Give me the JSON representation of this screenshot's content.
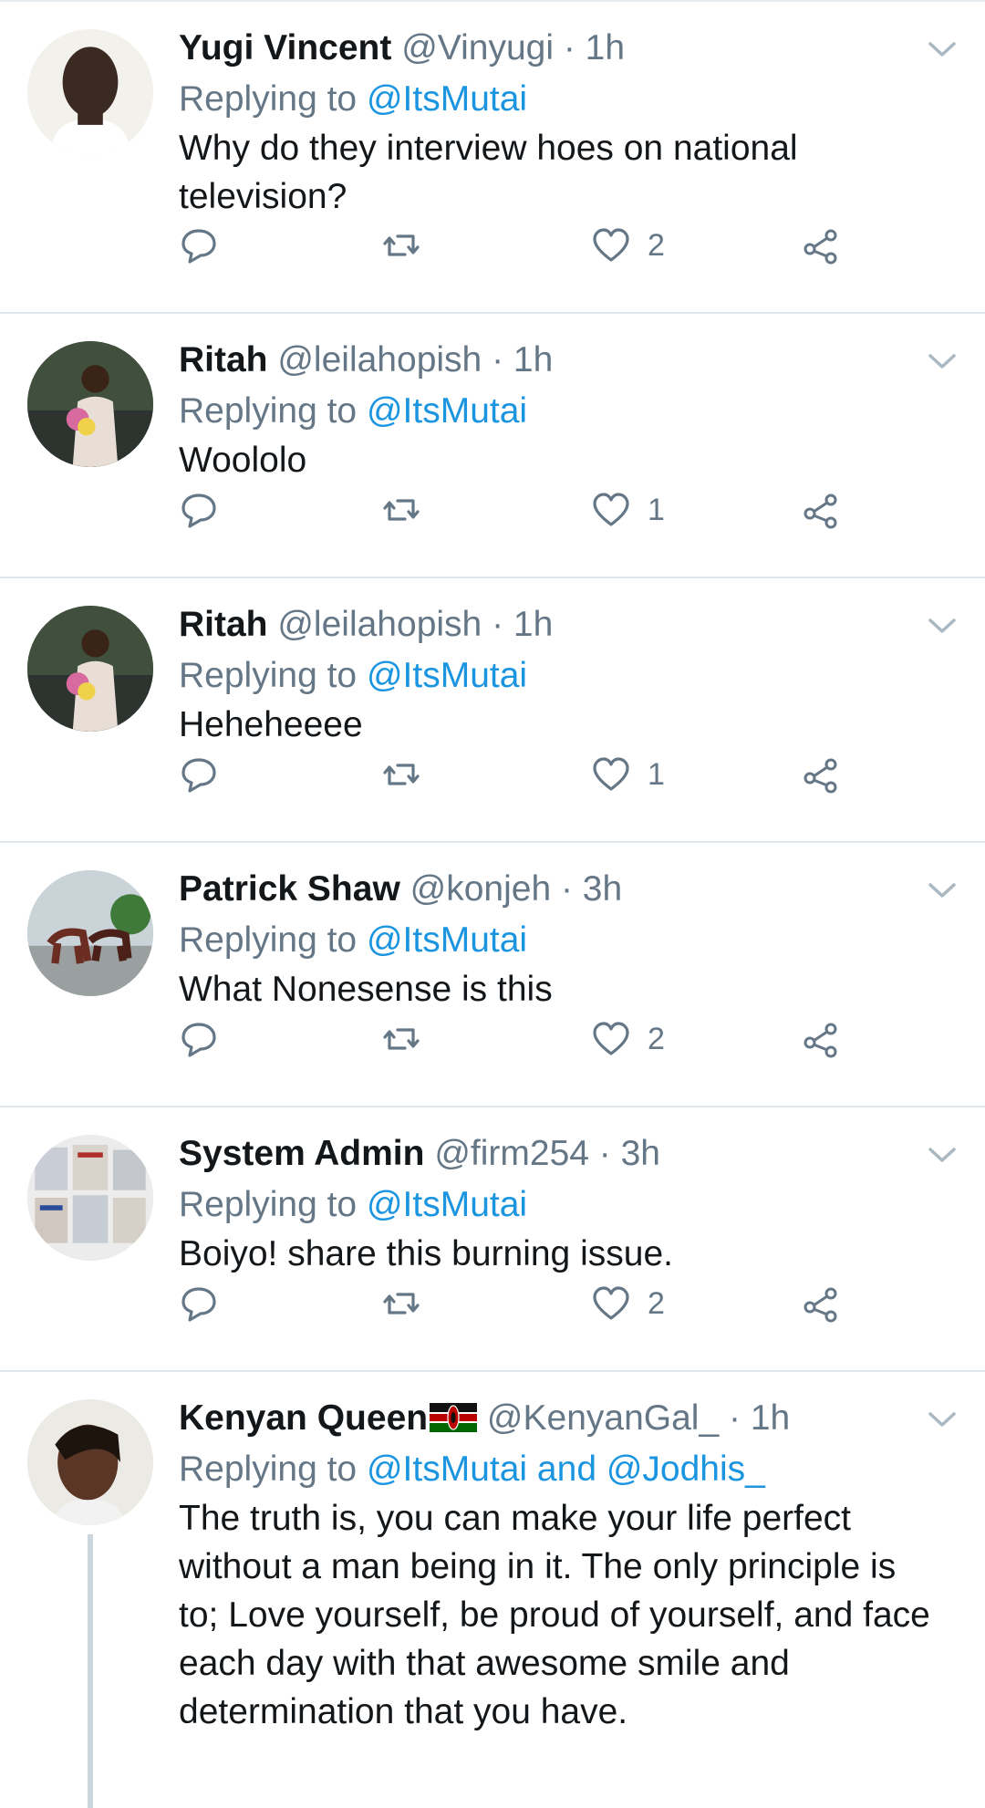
{
  "colors": {
    "link": "#1b95e0",
    "muted": "#657786",
    "text": "#14171a",
    "divider": "#e1e8ed"
  },
  "replies_prefix": "Replying to",
  "tweets": [
    {
      "name": "Yugi Vincent",
      "handle": "@Vinyugi",
      "time": "· 1h",
      "mention": "@ItsMutai",
      "text": "Why do they interview hoes on national television?",
      "likes": "2"
    },
    {
      "name": "Ritah",
      "handle": "@leilahopish",
      "time": "· 1h",
      "mention": "@ItsMutai",
      "text": "Woololo",
      "likes": "1"
    },
    {
      "name": "Ritah",
      "handle": "@leilahopish",
      "time": "· 1h",
      "mention": "@ItsMutai",
      "text": "Heheheeee",
      "likes": "1"
    },
    {
      "name": "Patrick Shaw",
      "handle": "@konjeh",
      "time": "· 3h",
      "mention": "@ItsMutai",
      "text": "What Nonesense is this",
      "likes": "2"
    },
    {
      "name": "System Admin",
      "handle": "@firm254",
      "time": "· 3h",
      "mention": "@ItsMutai",
      "text": "Boiyo! share this burning issue.",
      "likes": "2"
    },
    {
      "name": "Kenyan Queen",
      "handle": "@KenyanGal_",
      "time": "· 1h",
      "mention": "@ItsMutai and @Jodhis_",
      "text": "The truth is, you can make your life perfect without a man being in it. The only principle is to; Love yourself, be proud of yourself, and face each day with that awesome smile and determination that you have."
    }
  ],
  "icons": {
    "reply": "reply-icon",
    "retweet": "retweet-icon",
    "like": "heart-icon",
    "share": "share-icon",
    "more": "chevron-down-icon",
    "flag": "kenya-flag-icon"
  }
}
